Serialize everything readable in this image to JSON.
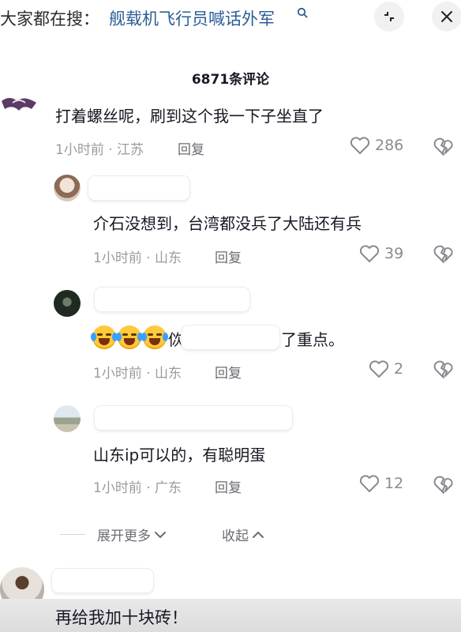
{
  "header": {
    "search_prefix": "大家都在搜：",
    "search_query": "舰载机飞行员喊话外军"
  },
  "comments_count_title": "6871条评论",
  "comments": [
    {
      "text": "打着螺丝呢，刷到这个我一下子坐直了",
      "meta": "1小时前 · 江苏",
      "reply": "回复",
      "likes": "286"
    }
  ],
  "replies": [
    {
      "text": "介石没想到，台湾都没兵了大陆还有兵",
      "meta": "1小时前 · 山东",
      "reply": "回复",
      "likes": "39"
    },
    {
      "text_start": "佽",
      "text_end": "了重点。",
      "meta": "1小时前 · 山东",
      "reply": "回复",
      "likes": "2"
    },
    {
      "text": "山东ip可以的，有聪明蛋",
      "meta": "1小时前 · 广东",
      "reply": "回复",
      "likes": "12"
    }
  ],
  "thread_controls": {
    "expand_label": "展开更多",
    "collapse_label": "收起"
  },
  "bottom_comment": {
    "text": "再给我加十块砖！"
  },
  "colors": {
    "link_blue": "#2c5d96",
    "meta_gray": "#9a9ba1",
    "text_dark": "#161823"
  }
}
